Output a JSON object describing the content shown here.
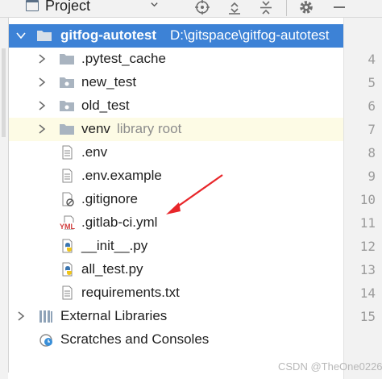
{
  "toolbar": {
    "project_label": "Project",
    "icons": [
      "project-view-icon",
      "chevron-down-icon",
      "locate-target-icon",
      "expand-all-icon",
      "collapse-all-icon",
      "gear-icon",
      "minimize-icon"
    ]
  },
  "tree": {
    "root": {
      "name": "gitfog-autotest",
      "path": "D:\\gitspace\\gitfog-autotest"
    },
    "items": [
      {
        "label": ".pytest_cache",
        "type": "folder"
      },
      {
        "label": "new_test",
        "type": "package"
      },
      {
        "label": "old_test",
        "type": "package"
      },
      {
        "label": "venv",
        "suffix": "library root",
        "type": "folder"
      },
      {
        "label": ".env",
        "type": "text-file"
      },
      {
        "label": ".env.example",
        "type": "text-file"
      },
      {
        "label": ".gitignore",
        "type": "ignore-file"
      },
      {
        "label": ".gitlab-ci.yml",
        "type": "yaml-file",
        "badge": "YML"
      },
      {
        "label": "__init__.py",
        "type": "python-file"
      },
      {
        "label": "all_test.py",
        "type": "python-file"
      },
      {
        "label": "requirements.txt",
        "type": "text-file"
      },
      {
        "label": "External Libraries",
        "type": "libraries"
      },
      {
        "label": "Scratches and Consoles",
        "type": "scratches"
      }
    ]
  },
  "gutter": {
    "line_numbers": [
      "4",
      "5",
      "6",
      "7",
      "8",
      "9",
      "10",
      "11",
      "12",
      "13",
      "14",
      "15"
    ]
  },
  "watermark": "CSDN @TheOne0226",
  "colors": {
    "selection": "#3d82d6",
    "hover_row": "#fdfbe5",
    "annotation_arrow": "#e8262a",
    "folder": "#a9b4c0",
    "python_blue": "#3a75b0",
    "python_yellow": "#f0c419"
  }
}
